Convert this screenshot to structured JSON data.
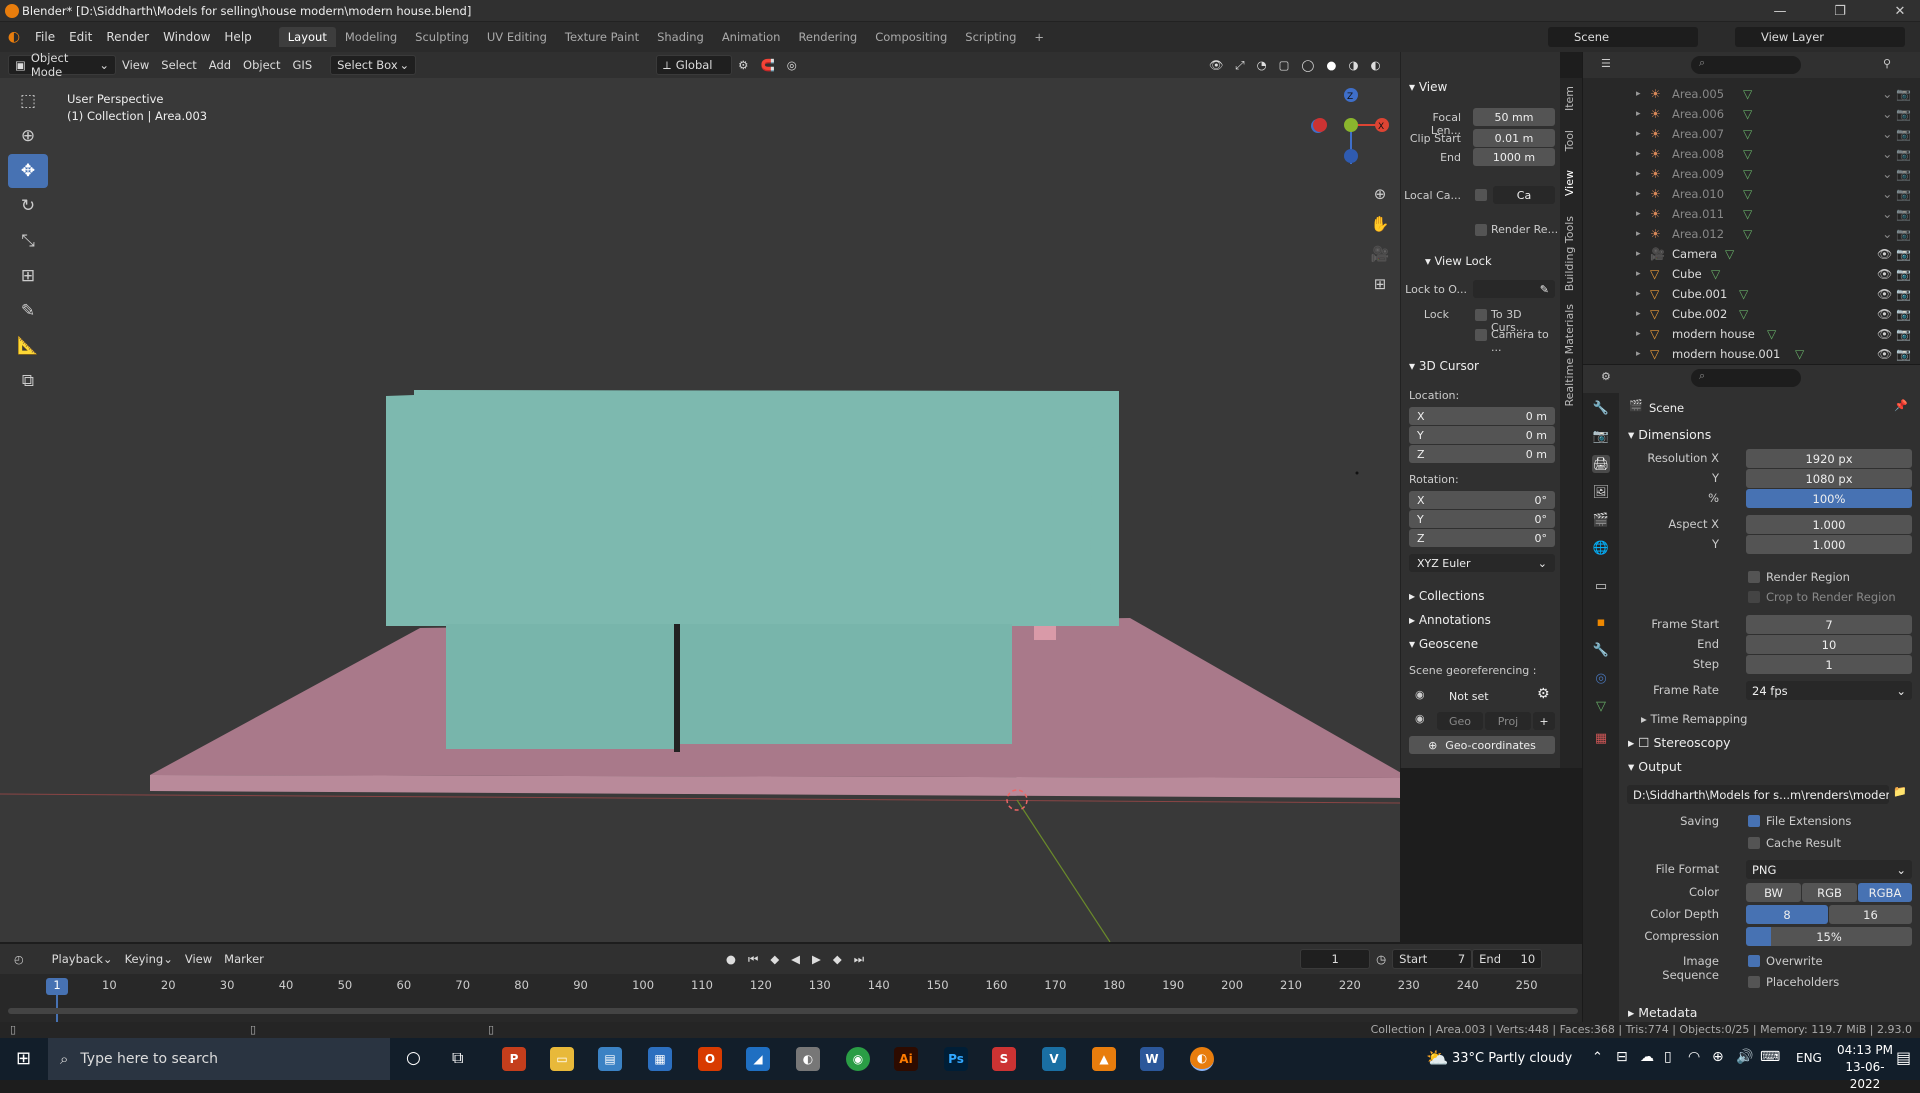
{
  "window": {
    "title": "Blender* [D:\\Siddharth\\Models for selling\\house modern\\modern house.blend]"
  },
  "menu": [
    "File",
    "Edit",
    "Render",
    "Window",
    "Help"
  ],
  "workspaces": [
    "Layout",
    "Modeling",
    "Sculpting",
    "UV Editing",
    "Texture Paint",
    "Shading",
    "Animation",
    "Rendering",
    "Compositing",
    "Scripting"
  ],
  "active_workspace": "Layout",
  "scene_name": "Scene",
  "view_layer": "View Layer",
  "header3d": {
    "mode": "Object Mode",
    "view": "View",
    "select": "Select",
    "add": "Add",
    "object": "Object",
    "gis": "GIS",
    "select_box": "Select Box",
    "orientation": "Global"
  },
  "viewport": {
    "perspective": "User Perspective",
    "collection": "(1) Collection | Area.003"
  },
  "npanel": {
    "view_header": "View",
    "focal_label": "Focal Len...",
    "focal_value": "50 mm",
    "clip_start_label": "Clip Start",
    "clip_start_value": "0.01 m",
    "end_label": "End",
    "end_value": "1000 m",
    "local_camera_label": "Local Ca...",
    "local_camera_value": "Ca",
    "render_region_label": "Render Re...",
    "view_lock_header": "View Lock",
    "lock_to_label": "Lock to O...",
    "lock_label": "Lock",
    "lock_cursor": "To 3D Curs...",
    "lock_camera": "Camera to ...",
    "cursor_header": "3D Cursor",
    "location_label": "Location:",
    "loc": [
      {
        "axis": "X",
        "value": "0 m"
      },
      {
        "axis": "Y",
        "value": "0 m"
      },
      {
        "axis": "Z",
        "value": "0 m"
      }
    ],
    "rotation_label": "Rotation:",
    "rot": [
      {
        "axis": "X",
        "value": "0°"
      },
      {
        "axis": "Y",
        "value": "0°"
      },
      {
        "axis": "Z",
        "value": "0°"
      }
    ],
    "rotation_mode": "XYZ Euler",
    "collections": "Collections",
    "annotations": "Annotations",
    "geoscene": "Geoscene",
    "georef_label": "Scene georeferencing :",
    "not_set": "Not set",
    "geo": "Geo",
    "proj": "Proj",
    "geo_coords": "Geo-coordinates"
  },
  "side_tabs": [
    "Item",
    "Tool",
    "View",
    "Building Tools",
    "Realtime Materials"
  ],
  "outliner": [
    {
      "name": "Area.005",
      "kind": "light"
    },
    {
      "name": "Area.006",
      "kind": "light"
    },
    {
      "name": "Area.007",
      "kind": "light"
    },
    {
      "name": "Area.008",
      "kind": "light"
    },
    {
      "name": "Area.009",
      "kind": "light"
    },
    {
      "name": "Area.010",
      "kind": "light"
    },
    {
      "name": "Area.011",
      "kind": "light"
    },
    {
      "name": "Area.012",
      "kind": "light"
    },
    {
      "name": "Camera",
      "kind": "camera"
    },
    {
      "name": "Cube",
      "kind": "mesh"
    },
    {
      "name": "Cube.001",
      "kind": "mesh"
    },
    {
      "name": "Cube.002",
      "kind": "mesh"
    },
    {
      "name": "modern house",
      "kind": "mesh"
    },
    {
      "name": "modern house.001",
      "kind": "mesh"
    }
  ],
  "props": {
    "context": "Scene",
    "dimensions": "Dimensions",
    "res_x_label": "Resolution X",
    "res_x": "1920 px",
    "res_y_label": "Y",
    "res_y": "1080 px",
    "pct_label": "%",
    "pct": "100%",
    "aspect_x_label": "Aspect X",
    "aspect_x": "1.000",
    "aspect_y_label": "Y",
    "aspect_y": "1.000",
    "render_region": "Render Region",
    "crop_region": "Crop to Render Region",
    "frame_start_label": "Frame Start",
    "frame_start": "7",
    "end_label": "End",
    "end": "10",
    "step_label": "Step",
    "step": "1",
    "frame_rate_label": "Frame Rate",
    "frame_rate": "24 fps",
    "time_remapping": "Time Remapping",
    "stereoscopy": "Stereoscopy",
    "output": "Output",
    "output_path": "D:\\Siddharth\\Models for s...m\\renders\\modern house",
    "saving_label": "Saving",
    "file_ext": "File Extensions",
    "cache_result": "Cache Result",
    "file_format_label": "File Format",
    "file_format": "PNG",
    "color_label": "Color",
    "color_opts": [
      "BW",
      "RGB",
      "RGBA"
    ],
    "depth_label": "Color Depth",
    "depth_opts": [
      "8",
      "16"
    ],
    "compression_label": "Compression",
    "compression": "15%",
    "image_seq_label": "Image Sequence",
    "overwrite": "Overwrite",
    "placeholders": "Placeholders",
    "metadata": "Metadata"
  },
  "timeline": {
    "playback": "Playback",
    "keying": "Keying",
    "view": "View",
    "marker": "Marker",
    "current_frame": "1",
    "start_label": "Start",
    "start": "7",
    "end_label": "End",
    "end": "10",
    "ticks": [
      "10",
      "20",
      "30",
      "40",
      "50",
      "60",
      "70",
      "80",
      "90",
      "100",
      "110",
      "120",
      "130",
      "140",
      "150",
      "160",
      "170",
      "180",
      "190",
      "200",
      "210",
      "220",
      "230",
      "240",
      "250"
    ],
    "frame_badge": "1"
  },
  "status": "Collection | Area.003 | Verts:448 | Faces:368 | Tris:774 | Objects:0/25 | Memory: 119.7 MiB | 2.93.0",
  "taskbar": {
    "search_placeholder": "Type here to search",
    "weather": "33°C  Partly cloudy",
    "lang": "ENG",
    "time": "04:13 PM",
    "date": "13-06-2022"
  },
  "colors": {
    "accent": "#4772b3",
    "house": "#78b5ab",
    "ground": "#a9798a",
    "viewport_bg": "#3a3a3a"
  }
}
